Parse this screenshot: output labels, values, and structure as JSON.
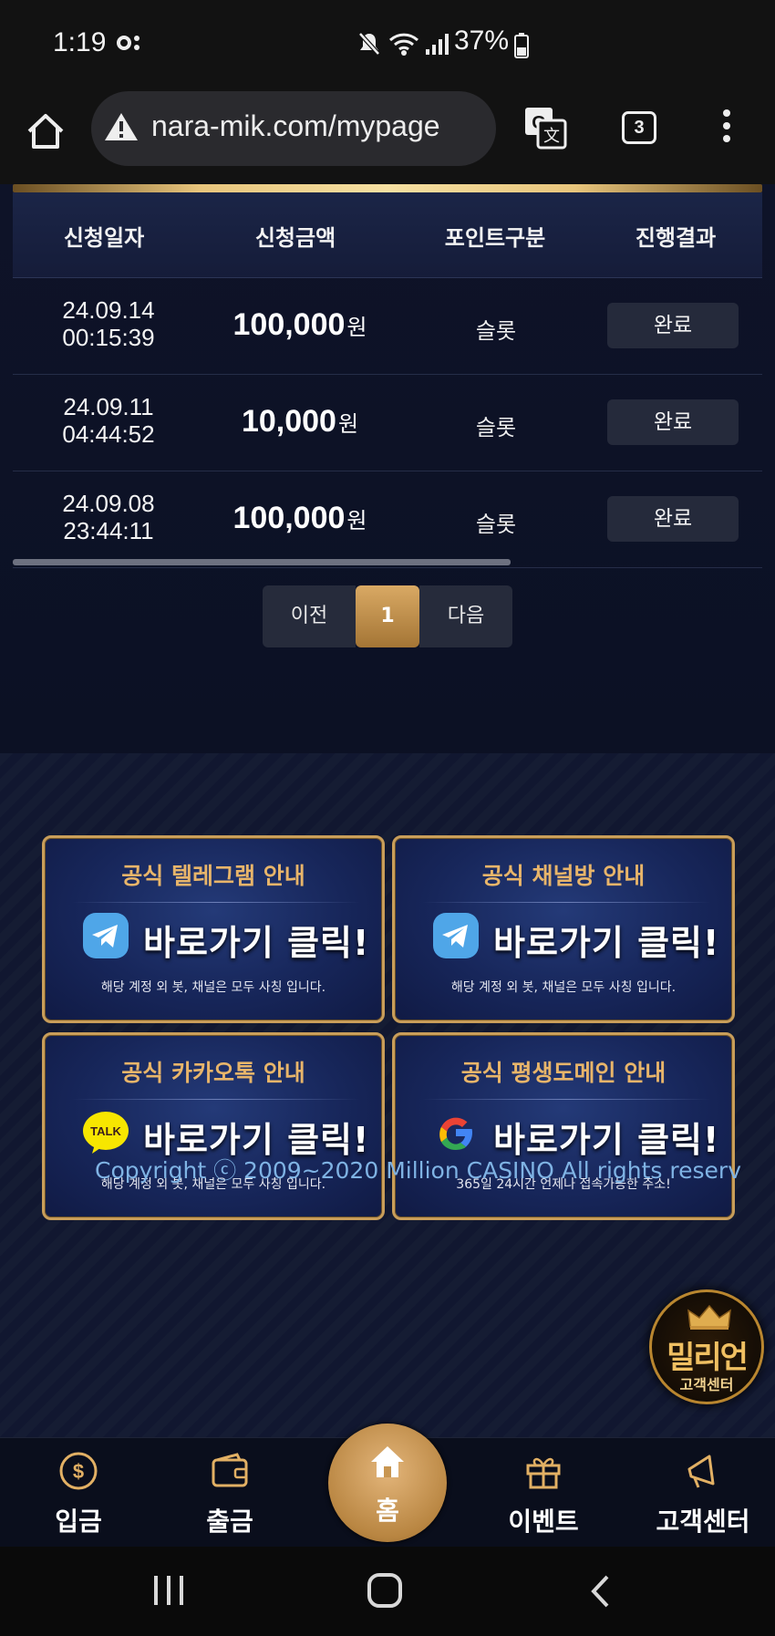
{
  "status_bar": {
    "time": "1:19",
    "battery": "37%"
  },
  "browser": {
    "url": "nara-mik.com/mypage",
    "tab_count": "3"
  },
  "table": {
    "headers": [
      "신청일자",
      "신청금액",
      "포인트구분",
      "진행결과"
    ],
    "rows": [
      {
        "date": "24.09.14",
        "time": "00:15:39",
        "amount": "100,000",
        "unit": "원",
        "type": "슬롯",
        "status": "완료"
      },
      {
        "date": "24.09.11",
        "time": "04:44:52",
        "amount": "10,000",
        "unit": "원",
        "type": "슬롯",
        "status": "완료"
      },
      {
        "date": "24.09.08",
        "time": "23:44:11",
        "amount": "100,000",
        "unit": "원",
        "type": "슬롯",
        "status": "완료"
      }
    ]
  },
  "pagination": {
    "prev": "이전",
    "current": "1",
    "next": "다음"
  },
  "banners": [
    {
      "title": "공식 텔레그램 안내",
      "cta": "바로가기 클릭!",
      "sub": "해당 계정 외 봇, 채널은 모두 사칭 입니다.",
      "icon": "telegram-icon"
    },
    {
      "title": "공식 채널방 안내",
      "cta": "바로가기 클릭!",
      "sub": "해당 계정 외 봇, 채널은 모두 사칭 입니다.",
      "icon": "telegram-icon"
    },
    {
      "title": "공식 카카오톡 안내",
      "cta": "바로가기 클릭!",
      "sub": "해당 계정 외 봇, 채널은 모두 사칭 입니다.",
      "icon": "kakaotalk-icon",
      "icon_text": "TALK"
    },
    {
      "title": "공식 평생도메인 안내",
      "cta": "바로가기 클릭!",
      "sub": "365일 24시간 언제나 접속가능한 주소!",
      "icon": "google-icon"
    }
  ],
  "footer": {
    "copyright": "Copyright ⓒ 2009~2020 Million CASINO All rights reserv"
  },
  "support_badge": {
    "name": "밀리언",
    "sub": "고객센터"
  },
  "bottom_nav": {
    "deposit": "입금",
    "withdraw": "출금",
    "home": "홈",
    "event": "이벤트",
    "support": "고객센터"
  },
  "colors": {
    "gold": "#c99e5a",
    "accent": "#d9a964",
    "copyright": "#7fb3e4"
  }
}
